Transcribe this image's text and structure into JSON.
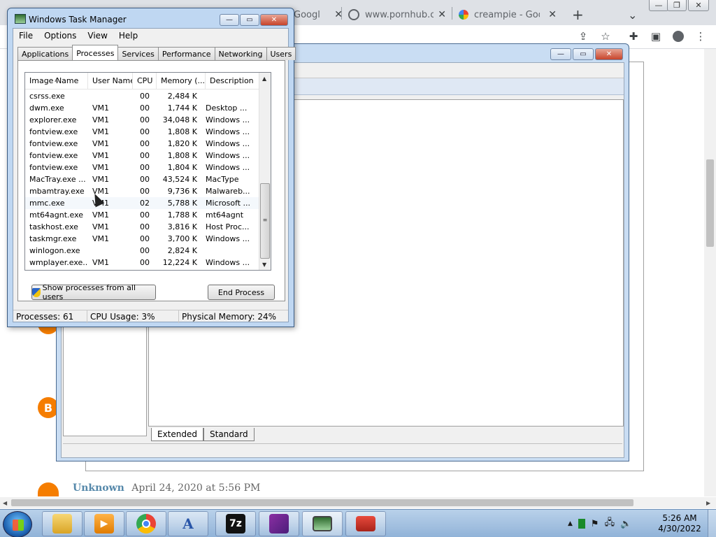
{
  "browser": {
    "tabs": [
      {
        "label": "Googl",
        "favicon": "google-icon"
      },
      {
        "label": "www.pornhub.co",
        "favicon": "globe-icon"
      },
      {
        "label": "creampie - Googl",
        "favicon": "google-icon"
      }
    ],
    "new_tab": "+",
    "tab_list": "⌄",
    "comment": {
      "author": "Unknown",
      "date": "April 24, 2020 at 5:56 PM"
    }
  },
  "mmc": {
    "tabs": [
      "Extended",
      "Standard"
    ]
  },
  "task_manager": {
    "title": "Windows Task Manager",
    "menu": [
      "File",
      "Options",
      "View",
      "Help"
    ],
    "tabs": [
      "Applications",
      "Processes",
      "Services",
      "Performance",
      "Networking",
      "Users"
    ],
    "active_tab": "Processes",
    "columns": [
      "Image Name",
      "User Name",
      "CPU",
      "Memory (...",
      "Description"
    ],
    "rows": [
      {
        "name": "csrss.exe",
        "user": "",
        "cpu": "00",
        "mem": "2,484 K",
        "desc": ""
      },
      {
        "name": "dwm.exe",
        "user": "VM1",
        "cpu": "00",
        "mem": "1,744 K",
        "desc": "Desktop ..."
      },
      {
        "name": "explorer.exe",
        "user": "VM1",
        "cpu": "00",
        "mem": "34,048 K",
        "desc": "Windows ..."
      },
      {
        "name": "fontview.exe",
        "user": "VM1",
        "cpu": "00",
        "mem": "1,808 K",
        "desc": "Windows ..."
      },
      {
        "name": "fontview.exe",
        "user": "VM1",
        "cpu": "00",
        "mem": "1,820 K",
        "desc": "Windows ..."
      },
      {
        "name": "fontview.exe",
        "user": "VM1",
        "cpu": "00",
        "mem": "1,808 K",
        "desc": "Windows ..."
      },
      {
        "name": "fontview.exe",
        "user": "VM1",
        "cpu": "00",
        "mem": "1,804 K",
        "desc": "Windows ..."
      },
      {
        "name": "MacTray.exe ...",
        "user": "VM1",
        "cpu": "00",
        "mem": "43,524 K",
        "desc": "MacType"
      },
      {
        "name": "mbamtray.exe",
        "user": "VM1",
        "cpu": "00",
        "mem": "9,736 K",
        "desc": "Malwareb..."
      },
      {
        "name": "mmc.exe",
        "user": "VM1",
        "cpu": "02",
        "mem": "5,788 K",
        "desc": "Microsoft ..."
      },
      {
        "name": "mt64agnt.exe",
        "user": "VM1",
        "cpu": "00",
        "mem": "1,788 K",
        "desc": "mt64agnt"
      },
      {
        "name": "taskhost.exe",
        "user": "VM1",
        "cpu": "00",
        "mem": "3,816 K",
        "desc": "Host Proc..."
      },
      {
        "name": "taskmgr.exe",
        "user": "VM1",
        "cpu": "00",
        "mem": "3,700 K",
        "desc": "Windows ..."
      },
      {
        "name": "winlogon.exe",
        "user": "",
        "cpu": "00",
        "mem": "2,824 K",
        "desc": ""
      },
      {
        "name": "wmplayer.exe...",
        "user": "VM1",
        "cpu": "00",
        "mem": "12,224 K",
        "desc": "Windows ..."
      }
    ],
    "show_all_label": "Show processes from all users",
    "end_process_label": "End Process",
    "status": {
      "processes": "Processes: 61",
      "cpu": "CPU Usage: 3%",
      "memory": "Physical Memory: 24%"
    }
  },
  "taskbar": {
    "apps": [
      "explorer-icon",
      "media-player-icon",
      "chrome-icon",
      "font-icon",
      "7zip-icon",
      "windows-flag-icon",
      "task-manager-icon",
      "toolbox-icon"
    ],
    "glyph_7z": "7z",
    "clock_time": "5:26 AM",
    "clock_date": "4/30/2022"
  }
}
